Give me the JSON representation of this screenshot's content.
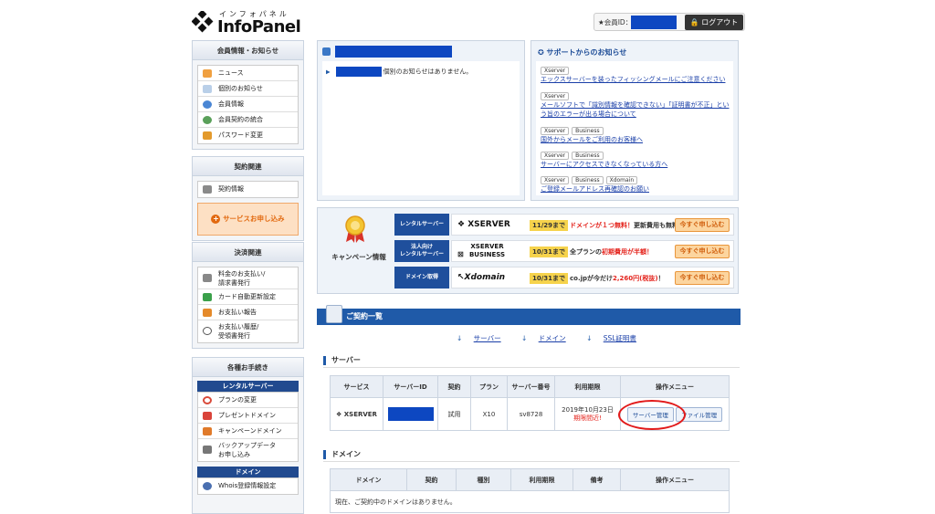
{
  "header": {
    "logo_sub": "インフォパネル",
    "logo_main": "InfoPanel",
    "member_label": "★会員ID：",
    "logout_label": "ログアウト"
  },
  "sidebar": {
    "member": {
      "title": "会員情報・お知らせ",
      "items": [
        {
          "label": "ニュース",
          "icon": "news-icon",
          "color": "#f0a040"
        },
        {
          "label": "個別のお知らせ",
          "icon": "mail-icon",
          "color": "#7fa8d8"
        },
        {
          "label": "会員情報",
          "icon": "user-icon",
          "color": "#4a86d4"
        },
        {
          "label": "会員契約の統合",
          "icon": "merge-icon",
          "color": "#5aa05a"
        },
        {
          "label": "パスワード変更",
          "icon": "lock-icon",
          "color": "#e39a2c"
        }
      ]
    },
    "contract": {
      "title": "契約関連",
      "items": [
        {
          "label": "契約情報",
          "icon": "doc-icon",
          "color": "#8a8a8a"
        }
      ],
      "apply_label": "サービスお申し込み"
    },
    "payment": {
      "title": "決済関連",
      "items": [
        {
          "label1": "料金のお支払い/",
          "label2": "請求書発行",
          "icon": "invoice-icon",
          "color": "#888"
        },
        {
          "label": "カード自動更新設定",
          "icon": "card-icon",
          "color": "#3aa04a"
        },
        {
          "label": "お支払い報告",
          "icon": "report-icon",
          "color": "#e58a2a"
        },
        {
          "label1": "お支払い履歴/",
          "label2": "受領書発行",
          "icon": "clock-icon",
          "color": "#666"
        }
      ]
    },
    "procedures": {
      "title": "各種お手続き",
      "rental_title": "レンタルサーバー",
      "items": [
        {
          "label": "プランの変更",
          "icon": "refresh-icon",
          "color": "#d94a3a"
        },
        {
          "label": "プレゼントドメイン",
          "icon": "gift-icon",
          "color": "#d9433a"
        },
        {
          "label": "キャンペーンドメイン",
          "icon": "campaign-icon",
          "color": "#e07a2a"
        },
        {
          "label1": "バックアップデータ",
          "label2": "お申し込み",
          "icon": "backup-icon",
          "color": "#777"
        }
      ],
      "domain_title": "ドメイン",
      "domain_items": [
        {
          "label": "Whois登録情報設定",
          "icon": "whois-icon",
          "color": "#4a6fb0"
        }
      ]
    }
  },
  "notice": {
    "message": "個別のお知らせはありません。"
  },
  "support": {
    "title": "サポートからのお知らせ",
    "items": [
      {
        "tags": [
          "Xserver"
        ],
        "text": "エックスサーバーを装ったフィッシングメールにご注意ください"
      },
      {
        "tags": [
          "Xserver"
        ],
        "text": "メールソフトで「識別情報を確認できない」「証明書が不正」という旨のエラーが出る場合について"
      },
      {
        "tags": [
          "Xserver",
          "Business"
        ],
        "text": "国外からメールをご利用のお客様へ"
      },
      {
        "tags": [
          "Xserver",
          "Business"
        ],
        "text": "サーバーにアクセスできなくなっている方へ"
      },
      {
        "tags": [
          "Xserver",
          "Business",
          "Xdomain"
        ],
        "text": "ご登録メールアドレス再確認のお願い"
      }
    ]
  },
  "campaign": {
    "title": "キャンペーン情報",
    "rows": [
      {
        "cat1": "レンタルサーバー",
        "cat2": "",
        "brand": "XSERVER",
        "date": "11/29まで",
        "pre": "ドメインが１つ無料！",
        "mid": "更新費用も無料！",
        "post": "",
        "apply": "今すぐ申し込む"
      },
      {
        "cat1": "法人向け",
        "cat2": "レンタルサーバー",
        "brand": "XSERVER BUSINESS",
        "date": "10/31まで",
        "pre": "全プランの",
        "mid": "初期費用が半額！",
        "post": "",
        "apply": "今すぐ申し込む"
      },
      {
        "cat1": "ドメイン取得",
        "cat2": "",
        "brand": "Xdomain",
        "date": "10/31まで",
        "pre": "co.jpが今だけ",
        "mid": "2,260円(税抜)",
        "post": "！",
        "apply": "今すぐ申し込む"
      }
    ]
  },
  "contracts": {
    "title": "ご契約一覧",
    "jumps": [
      "サーバー",
      "ドメイン",
      "SSL証明書"
    ],
    "server_section": "サーバー",
    "server_headers": [
      "サービス",
      "サーバーID",
      "契約",
      "プラン",
      "サーバー番号",
      "利用期限",
      "操作メニュー"
    ],
    "server_row": {
      "service": "XSERVER",
      "contract": "試用",
      "plan": "X10",
      "number": "sv8728",
      "expiry": "2019年10月23日",
      "expiry_note": "期限間近!",
      "btn_manage": "サーバー管理",
      "btn_file": "ファイル管理"
    },
    "domain_section": "ドメイン",
    "domain_headers": [
      "ドメイン",
      "契約",
      "種別",
      "利用期限",
      "備考",
      "操作メニュー"
    ],
    "domain_empty": "現在、ご契約中のドメインはありません。"
  },
  "colors": {
    "accent": "#1f5aa8",
    "redacted": "#0d47c1",
    "highlight_circle": "#e21a1a"
  }
}
